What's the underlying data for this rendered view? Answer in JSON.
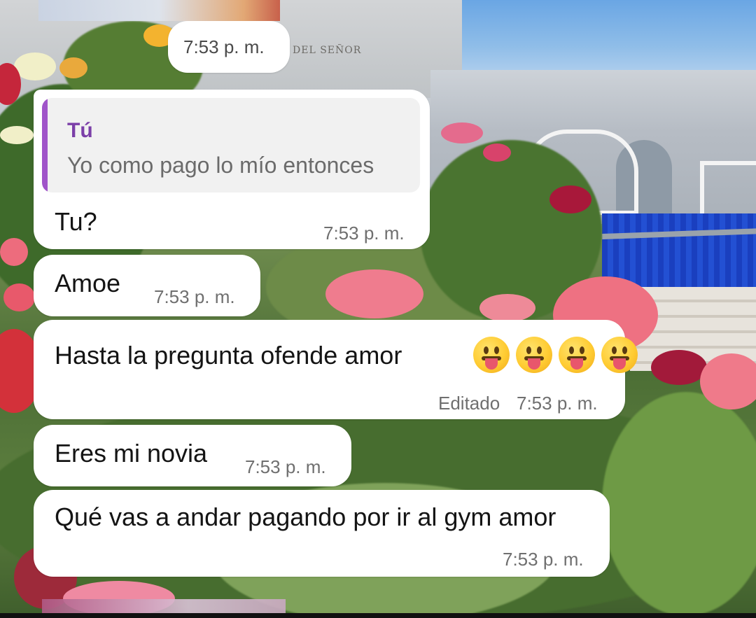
{
  "wallpaper": {
    "engraving": "DEL SEÑOR"
  },
  "chat": {
    "date_pill": {
      "time": "7:53 p. m."
    },
    "messages": [
      {
        "quote_author": "Tú",
        "quote_text": "Yo como pago lo mío entonces",
        "text": "Tu?",
        "time": "7:53 p. m."
      },
      {
        "text": "Amoe",
        "time": "7:53 p. m."
      },
      {
        "text": "Hasta la pregunta ofende amor",
        "emoji": [
          "face-with-tongue-icon",
          "face-with-tongue-icon",
          "face-with-tongue-icon",
          "face-with-tongue-icon"
        ],
        "edited": "Editado",
        "time": "7:53 p. m."
      },
      {
        "text": "Eres mi novia",
        "time": "7:53 p. m."
      },
      {
        "text": "Qué vas a andar pagando por ir al gym amor",
        "time": "7:53 p. m."
      }
    ]
  },
  "colors": {
    "bubble": "#ffffff",
    "quote_accent": "#a054c9",
    "quote_author": "#7b3fa8",
    "text": "#141414",
    "meta": "#6f6f6f"
  }
}
